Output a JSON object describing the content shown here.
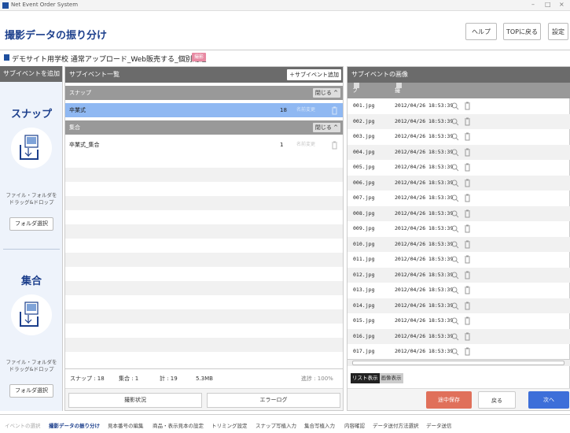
{
  "window": {
    "title": "Net Event Order System",
    "controls": [
      "–",
      "□",
      "×"
    ]
  },
  "header": {
    "page_title": "撮影データの振り分け",
    "help_label": "ヘルプ",
    "top_label": "TOPに戻る",
    "settings_label": "設定"
  },
  "event": {
    "name": "デモサイト用学校 通常アップロード_Web販売する_個別配送",
    "badge": "撮影"
  },
  "left_panel": {
    "title": "サブイベントを追加",
    "zones": [
      {
        "title": "スナップ",
        "text_line1": "ファイル・フォルダを",
        "text_line2": "ドラッグ&ドロップ",
        "button": "フォルダ選択"
      },
      {
        "title": "集合",
        "text_line1": "ファイル・フォルダを",
        "text_line2": "ドラッグ&ドロップ",
        "button": "フォルダ選択"
      }
    ]
  },
  "subevents": {
    "title": "サブイベント一覧",
    "add_label": "サブイベント追加",
    "groups": [
      {
        "name": "スナップ",
        "close_label": "閉じる",
        "items": [
          {
            "name": "卒業式",
            "count": "18",
            "rename_label": "名前変更",
            "selected": true
          }
        ]
      },
      {
        "name": "集合",
        "close_label": "閉じる",
        "items": [
          {
            "name": "卒業式_集合",
            "count": "1",
            "rename_label": "名前変更",
            "selected": false
          }
        ]
      }
    ],
    "footer": {
      "snap_label": "スナップ : 18",
      "group_label": "集合 : 1",
      "total_label": "計 : 19",
      "size_label": "5.3MB",
      "progress_label": "進捗 : 100%"
    },
    "status_button": "撮影状況",
    "error_button": "エラーログ"
  },
  "images": {
    "title": "サブイベントの画像",
    "col_filename": "ファイル名",
    "col_date": "撮影日",
    "rows": [
      {
        "file": "001.jpg",
        "date": "2012/04/26 18:53:39"
      },
      {
        "file": "002.jpg",
        "date": "2012/04/26 18:53:39"
      },
      {
        "file": "003.jpg",
        "date": "2012/04/26 18:53:39"
      },
      {
        "file": "004.jpg",
        "date": "2012/04/26 18:53:39"
      },
      {
        "file": "005.jpg",
        "date": "2012/04/26 18:53:39"
      },
      {
        "file": "006.jpg",
        "date": "2012/04/26 18:53:39"
      },
      {
        "file": "007.jpg",
        "date": "2012/04/26 18:53:39"
      },
      {
        "file": "008.jpg",
        "date": "2012/04/26 18:53:39"
      },
      {
        "file": "009.jpg",
        "date": "2012/04/26 18:53:39"
      },
      {
        "file": "010.jpg",
        "date": "2012/04/26 18:53:39"
      },
      {
        "file": "011.jpg",
        "date": "2012/04/26 18:53:39"
      },
      {
        "file": "012.jpg",
        "date": "2012/04/26 18:53:39"
      },
      {
        "file": "013.jpg",
        "date": "2012/04/26 18:53:39"
      },
      {
        "file": "014.jpg",
        "date": "2012/04/26 18:53:39"
      },
      {
        "file": "015.jpg",
        "date": "2012/04/26 18:53:39"
      },
      {
        "file": "016.jpg",
        "date": "2012/04/26 18:53:39"
      },
      {
        "file": "017.jpg",
        "date": "2012/04/26 18:53:39"
      }
    ],
    "view_list": "リスト表示",
    "view_image": "画像表示",
    "save_label": "途中保存",
    "back_label": "戻る",
    "next_label": "次へ"
  },
  "steps": [
    {
      "label": "イベントの選択",
      "state": "done"
    },
    {
      "label": "撮影データの振り分け",
      "state": "current"
    },
    {
      "label": "見本番号の編集",
      "state": "todo"
    },
    {
      "label": "商品・表示見本の設定",
      "state": "todo"
    },
    {
      "label": "トリミング設定",
      "state": "todo"
    },
    {
      "label": "スナップ写植入力",
      "state": "todo"
    },
    {
      "label": "集合写植入力",
      "state": "todo"
    },
    {
      "label": "内容確認",
      "state": "todo"
    },
    {
      "label": "データ送付方法選択",
      "state": "todo"
    },
    {
      "label": "データ送信",
      "state": "todo"
    }
  ],
  "colors": {
    "brand_blue": "#1c3f8c",
    "panel_header": "#6b6b6b",
    "group_row": "#999999",
    "selected_row": "#8fb8f2",
    "save_button": "#e0705a",
    "next_button": "#3d6fd9"
  }
}
